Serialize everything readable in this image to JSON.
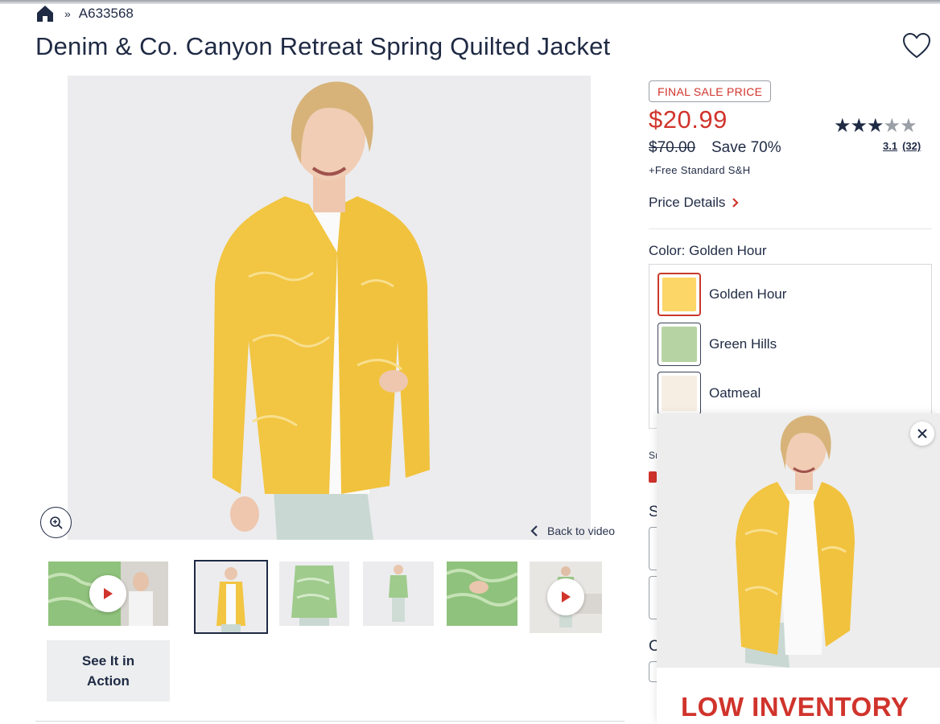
{
  "breadcrumb": {
    "home_icon": "home-icon",
    "separator": "»",
    "item_number": "A633568"
  },
  "product": {
    "title": "Denim & Co. Canyon Retreat Spring Quilted Jacket",
    "favorite_icon": "heart-icon"
  },
  "gallery": {
    "zoom_icon": "zoom-in-icon",
    "back_to_video": "Back to video",
    "see_it_in_action": "See It in\nAction",
    "thumbnails": [
      {
        "name": "video-thumbnail-1",
        "has_play": true
      },
      {
        "name": "thumbnail-front-yellow",
        "selected": true
      },
      {
        "name": "thumbnail-back-green"
      },
      {
        "name": "thumbnail-full-green"
      },
      {
        "name": "thumbnail-pocket-green"
      },
      {
        "name": "video-thumbnail-2",
        "has_play": true
      }
    ]
  },
  "pricing": {
    "badge": "FINAL SALE PRICE",
    "price": "$20.99",
    "original_price": "$70.00",
    "savings": "Save 70%",
    "shipping": "+Free Standard S&H",
    "price_details": "Price Details",
    "accent_color": "#d0342c"
  },
  "rating": {
    "stars_filled": 3,
    "stars_total": 5,
    "average": "3.1",
    "count": "(32)"
  },
  "color": {
    "label": "Color:",
    "selected": "Golden Hour",
    "options": [
      {
        "name": "Golden Hour",
        "hex": "#fcd667",
        "selected": true
      },
      {
        "name": "Green Hills",
        "hex": "#b6d4a3",
        "selected": false
      },
      {
        "name": "Oatmeal",
        "hex": "#f7eee3",
        "selected": false
      }
    ]
  },
  "partials": {
    "size_label_fragment": "Sı",
    "s_fragment": "S",
    "c_fragment": "C"
  },
  "float_video": {
    "banner": "LOW INVENTORY",
    "close_icon": "close-icon"
  }
}
